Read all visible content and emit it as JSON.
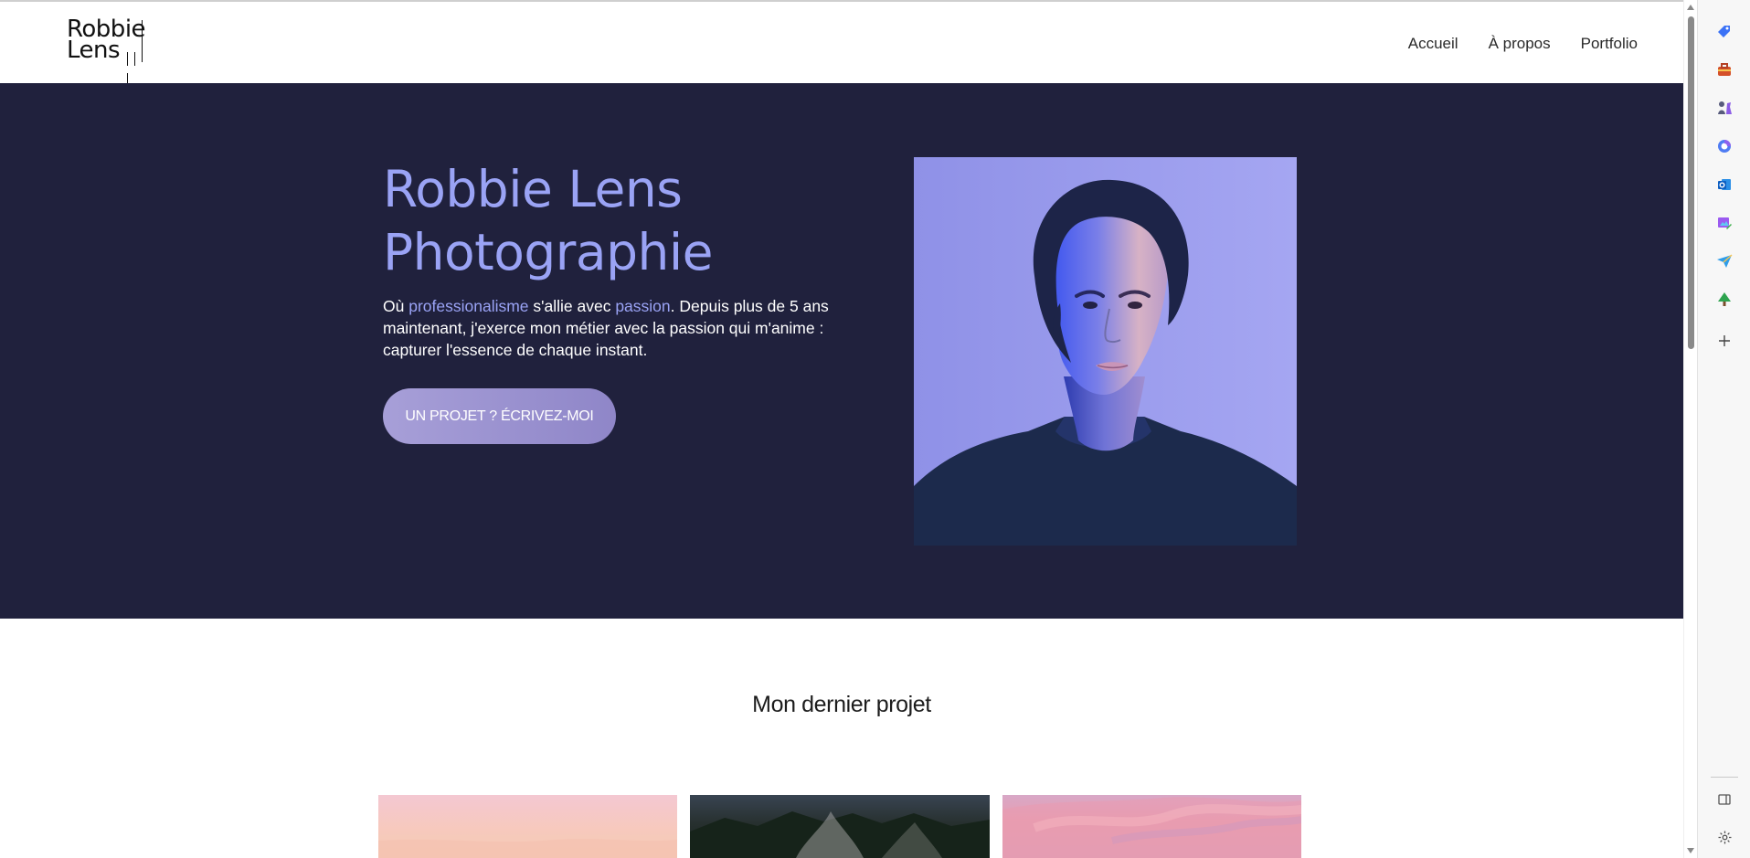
{
  "header": {
    "logo": {
      "line1": "Robbie",
      "line2": "Lens"
    },
    "nav": [
      {
        "label": "Accueil"
      },
      {
        "label": "À propos"
      },
      {
        "label": "Portfolio"
      }
    ]
  },
  "hero": {
    "title_line1": "Robbie Lens",
    "title_line2": "Photographie",
    "intro": {
      "part1": "Où ",
      "accent1": "professionalisme",
      "part2": " s'allie avec ",
      "accent2": "passion",
      "part3": ". Depuis plus de 5 ans maintenant, j'exerce mon métier avec la passion qui m'anime : capturer l'essence de chaque instant."
    },
    "cta_label": "UN PROJET ? ÉCRIVEZ-MOI"
  },
  "project_section": {
    "title": "Mon dernier projet"
  },
  "colors": {
    "hero_background": "#20213d",
    "accent": "#9aa3f5",
    "button": "#a79fd8",
    "header_background": "#ffffff"
  },
  "sidebar": {
    "icons": [
      "tag-icon",
      "briefcase-icon",
      "chess-icon",
      "copilot-icon",
      "outlook-icon",
      "image-edit-icon",
      "send-icon",
      "tree-icon",
      "add-icon",
      "sidebar-panel-icon",
      "settings-icon"
    ]
  }
}
